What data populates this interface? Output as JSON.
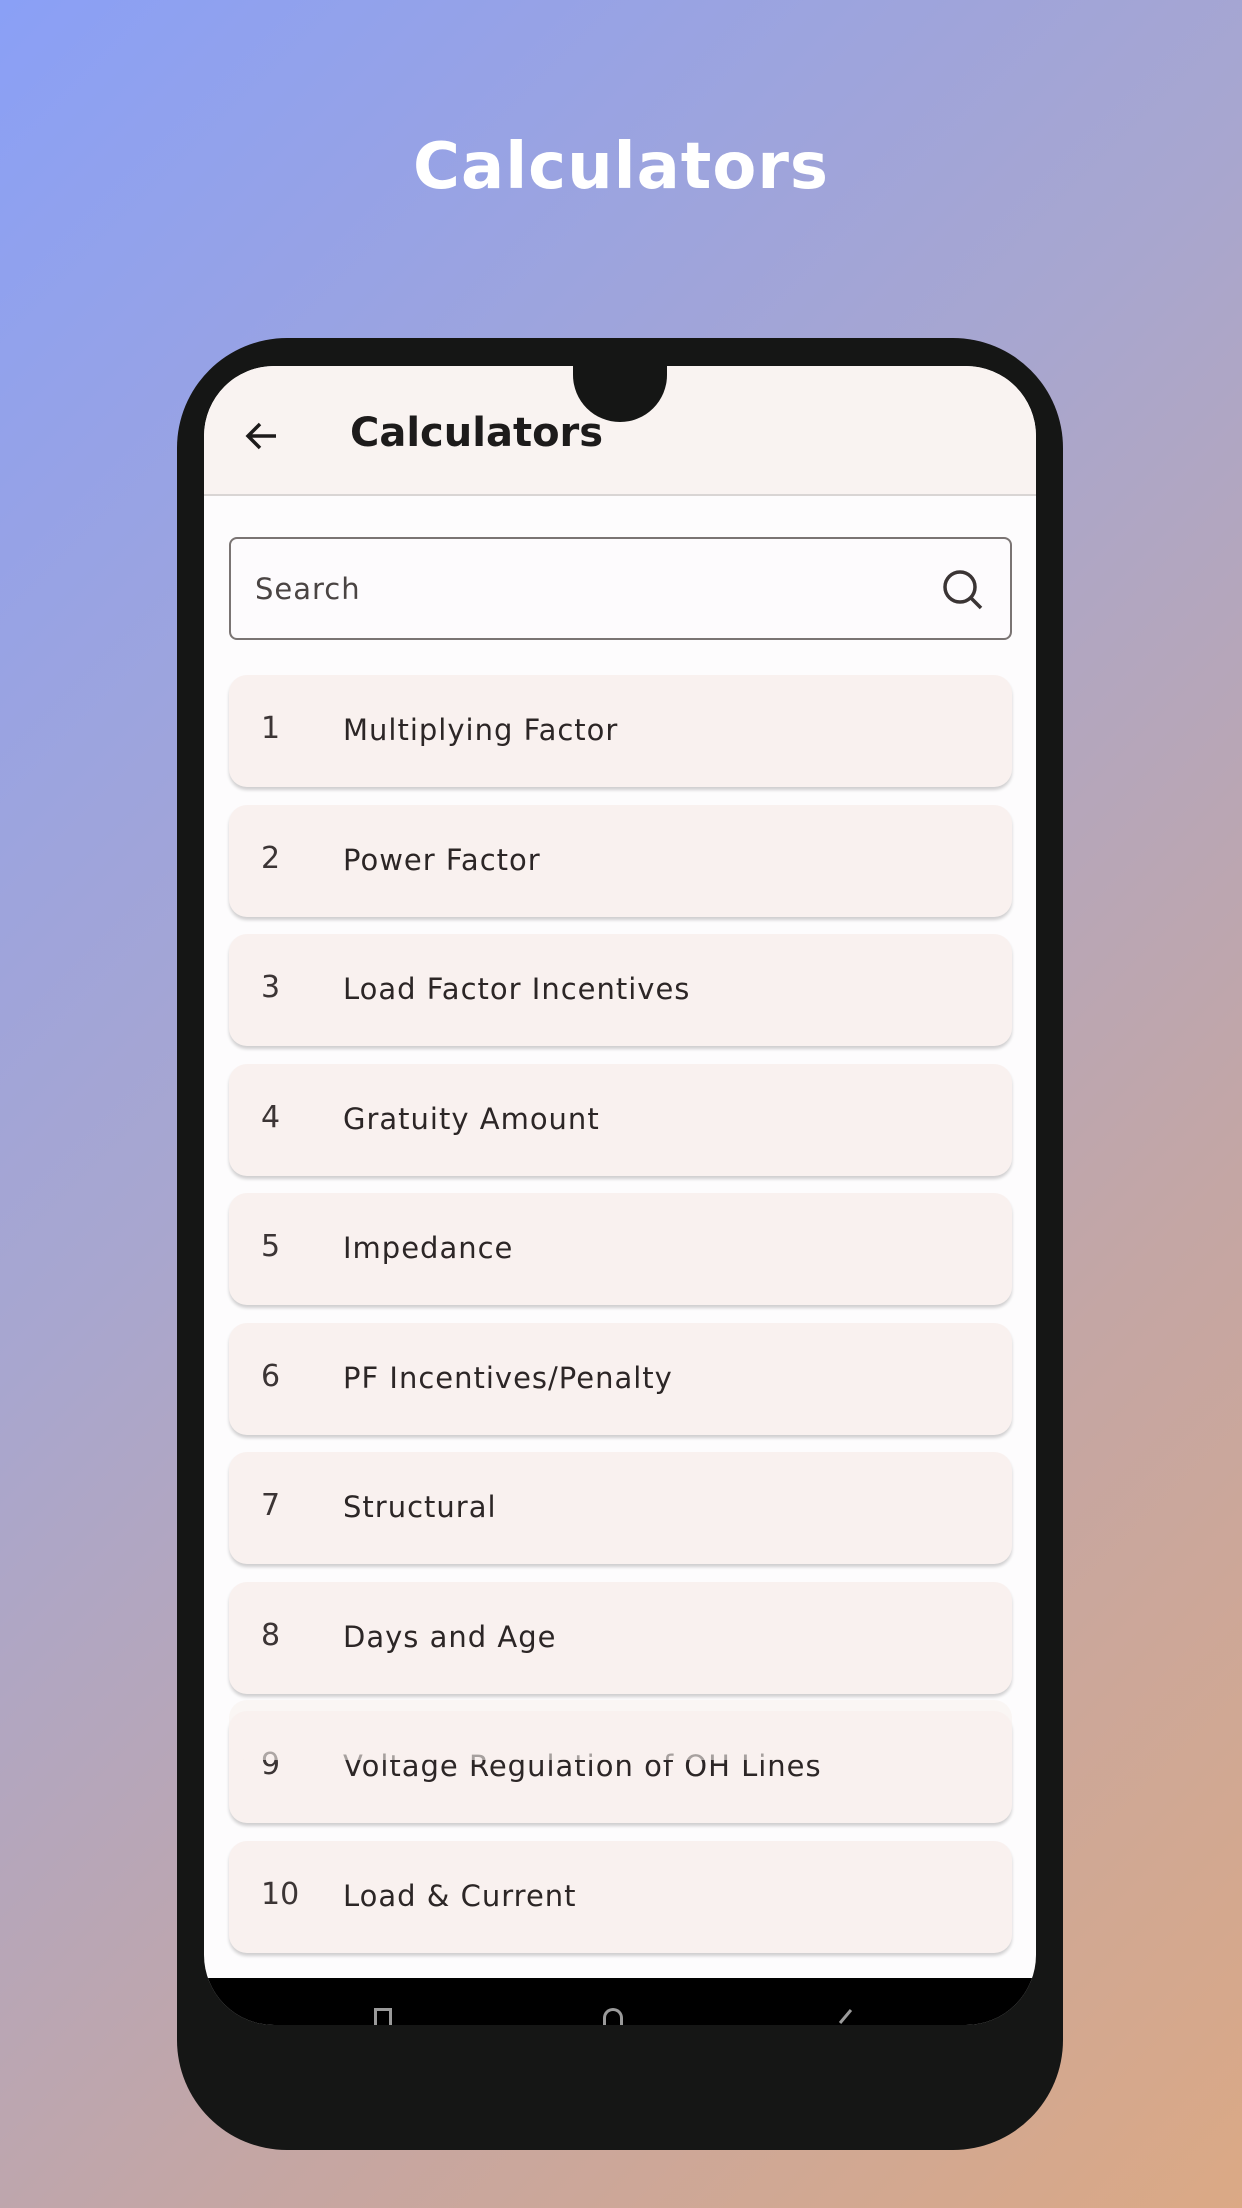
{
  "hero_title": "Calculators",
  "header": {
    "title": "Calculators"
  },
  "search": {
    "placeholder": "Search"
  },
  "items": [
    {
      "n": "1",
      "label": "Multiplying Factor"
    },
    {
      "n": "2",
      "label": "Power Factor"
    },
    {
      "n": "3",
      "label": "Load Factor Incentives"
    },
    {
      "n": "4",
      "label": "Gratuity Amount"
    },
    {
      "n": "5",
      "label": "Impedance"
    },
    {
      "n": "6",
      "label": "PF Incentives/Penalty"
    },
    {
      "n": "7",
      "label": "Structural"
    },
    {
      "n": "8",
      "label": "Days and Age"
    },
    {
      "n": "9",
      "label": "Voltage Regulation of OH Lines"
    },
    {
      "n": "10",
      "label": "Load & Current"
    }
  ],
  "icons": {
    "back": "arrow-left-icon",
    "search": "search-icon"
  }
}
